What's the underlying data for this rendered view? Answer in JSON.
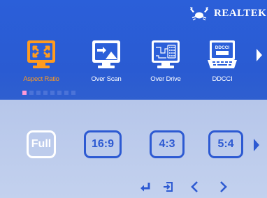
{
  "brand": {
    "name": "Realtek",
    "logo_icon": "realtek-crab-logo-icon"
  },
  "menu": {
    "items": [
      {
        "label": "Aspect Ratio",
        "icon": "aspect-ratio-icon",
        "selected": true
      },
      {
        "label": "Over Scan",
        "icon": "over-scan-icon",
        "selected": false
      },
      {
        "label": "Over Drive",
        "icon": "over-drive-icon",
        "selected": false
      },
      {
        "label": "DDCCI",
        "icon": "ddcci-icon",
        "selected": false,
        "icon_text": "DDCCI"
      }
    ],
    "next_icon": "chevron-right-icon",
    "page_count": 8,
    "active_page": 1
  },
  "options": {
    "items": [
      {
        "label": "Full",
        "selected": true
      },
      {
        "label": "16:9",
        "selected": false
      },
      {
        "label": "4:3",
        "selected": false
      },
      {
        "label": "5:4",
        "selected": false
      }
    ],
    "next_icon": "chevron-right-icon"
  },
  "nav": {
    "enter_icon": "enter-icon",
    "exit_icon": "exit-icon",
    "left_icon": "chevron-left-icon",
    "right_icon": "chevron-right-icon"
  },
  "colors": {
    "accent_blue": "#2d5ad2",
    "selected_orange": "#ff9b1f",
    "page_indicator_active": "#ff9ad6"
  }
}
